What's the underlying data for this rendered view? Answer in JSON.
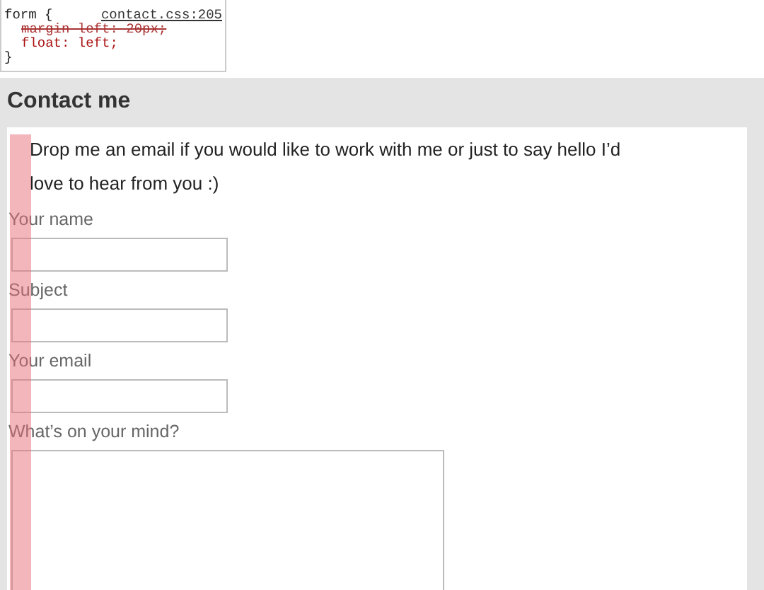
{
  "devtools_rule": {
    "selector": "form {",
    "source": "contact.css:205",
    "declarations": [
      {
        "text": "margin-left: 20px;",
        "struck": true
      },
      {
        "text": "float: left;",
        "struck": false
      }
    ],
    "closing": "}"
  },
  "page": {
    "title": "Contact me",
    "intro": "Drop me an email if you would like to work with me or just to say hello I’d love to hear from you :)",
    "fields": [
      {
        "label": "Your name",
        "kind": "input"
      },
      {
        "label": "Subject",
        "kind": "input"
      },
      {
        "label": "Your email",
        "kind": "input"
      },
      {
        "label": "What’s on your mind?",
        "kind": "textarea"
      }
    ]
  }
}
